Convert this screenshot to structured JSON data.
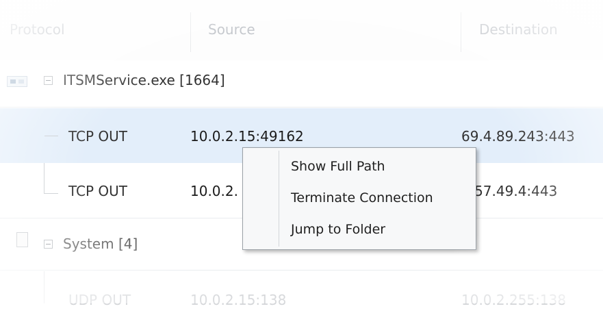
{
  "columns": {
    "protocol": "Protocol",
    "source": "Source",
    "destination": "Destination"
  },
  "groups": [
    {
      "name": "ITSMService.exe [1664]",
      "connections": [
        {
          "protocol": "TCP OUT",
          "source": "10.0.2.15:49162",
          "destination": "69.4.89.243:443"
        },
        {
          "protocol": "TCP OUT",
          "source": "10.0.2.",
          "destination": ".157.49.4:443"
        }
      ]
    },
    {
      "name": "System [4]",
      "connections": [
        {
          "protocol": "UDP OUT",
          "source": "10.0.2.15:138",
          "destination": "10.0.2.255:138"
        }
      ]
    }
  ],
  "context_menu": {
    "items": [
      "Show Full Path",
      "Terminate Connection",
      "Jump to Folder"
    ]
  },
  "icons": {
    "group1": "process-icon",
    "group2": "document-icon",
    "expander": "collapse-icon"
  },
  "colors": {
    "selection": "#e3eefa",
    "menu_bg": "#f7f8f9"
  }
}
